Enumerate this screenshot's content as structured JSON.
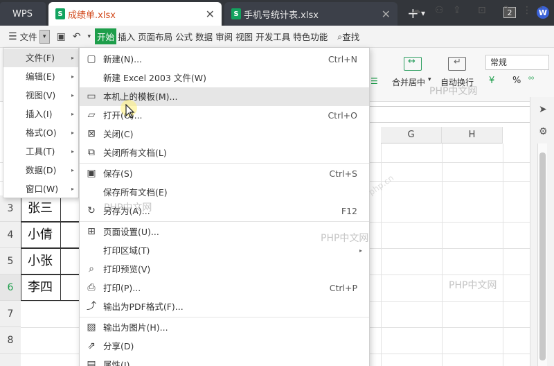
{
  "titlebar": {
    "tabs": [
      {
        "label": "WPS"
      },
      {
        "label": "成绩单.xlsx",
        "badge": "S"
      },
      {
        "label": "手机号统计表.xlsx",
        "badge": "S"
      }
    ],
    "close_glyph": "✕",
    "window_count": "2",
    "logo": "W"
  },
  "toolbar": {
    "menu_label": "文件",
    "ribbon_tabs": [
      "开始",
      "插入",
      "页面布局",
      "公式",
      "数据",
      "审阅",
      "视图",
      "开发工具",
      "特色功能"
    ],
    "find_label": "查找"
  },
  "ribbon": {
    "merge_center": "合并居中",
    "auto_wrap": "自动换行",
    "number_format": "常规",
    "currency_symbol": "¥",
    "percent_symbol": "%"
  },
  "sheet": {
    "columns": [
      "G",
      "H"
    ],
    "rows": [
      {
        "num": "3",
        "name": "张三"
      },
      {
        "num": "4",
        "name": "小倩"
      },
      {
        "num": "5",
        "name": "小张"
      },
      {
        "num": "6",
        "name": "李四"
      },
      {
        "num": "7",
        "name": ""
      },
      {
        "num": "8",
        "name": ""
      }
    ]
  },
  "file_menu": {
    "items": [
      {
        "label": "文件(F)"
      },
      {
        "label": "编辑(E)"
      },
      {
        "label": "视图(V)"
      },
      {
        "label": "插入(I)"
      },
      {
        "label": "格式(O)"
      },
      {
        "label": "工具(T)"
      },
      {
        "label": "数据(D)"
      },
      {
        "label": "窗口(W)"
      }
    ]
  },
  "submenu": {
    "items": [
      {
        "icon": "new-file-icon",
        "label": "新建(N)...",
        "shortcut": "Ctrl+N"
      },
      {
        "icon": "",
        "label": "新建 Excel 2003 文件(W)",
        "shortcut": ""
      },
      {
        "icon": "template-icon",
        "label": "本机上的模板(M)...",
        "shortcut": ""
      },
      {
        "icon": "open-folder-icon",
        "label": "打开(O)...",
        "shortcut": "Ctrl+O"
      },
      {
        "icon": "close-doc-icon",
        "label": "关闭(C)",
        "shortcut": ""
      },
      {
        "icon": "close-all-icon",
        "label": "关闭所有文档(L)",
        "shortcut": ""
      },
      {
        "icon": "save-icon",
        "label": "保存(S)",
        "shortcut": "Ctrl+S"
      },
      {
        "icon": "",
        "label": "保存所有文档(E)",
        "shortcut": ""
      },
      {
        "icon": "save-as-icon",
        "label": "另存为(A)...",
        "shortcut": "F12"
      },
      {
        "icon": "page-setup-icon",
        "label": "页面设置(U)...",
        "shortcut": ""
      },
      {
        "icon": "",
        "label": "打印区域(T)",
        "shortcut": ""
      },
      {
        "icon": "print-preview-icon",
        "label": "打印预览(V)",
        "shortcut": ""
      },
      {
        "icon": "print-icon",
        "label": "打印(P)...",
        "shortcut": "Ctrl+P"
      },
      {
        "icon": "pdf-export-icon",
        "label": "输出为PDF格式(F)...",
        "shortcut": ""
      },
      {
        "icon": "image-export-icon",
        "label": "输出为图片(H)...",
        "shortcut": ""
      },
      {
        "icon": "share-icon",
        "label": "分享(D)",
        "shortcut": ""
      },
      {
        "icon": "properties-icon",
        "label": "属性(I)",
        "shortcut": ""
      }
    ]
  },
  "watermarks": [
    "PHP中文网",
    "PHP中文网",
    "PHP中文网",
    "PHP中文网",
    "php.cn"
  ],
  "colors": {
    "accent_green": "#1e9e4b",
    "titlebar": "#33363b",
    "active_tab_text": "#d2491b"
  }
}
